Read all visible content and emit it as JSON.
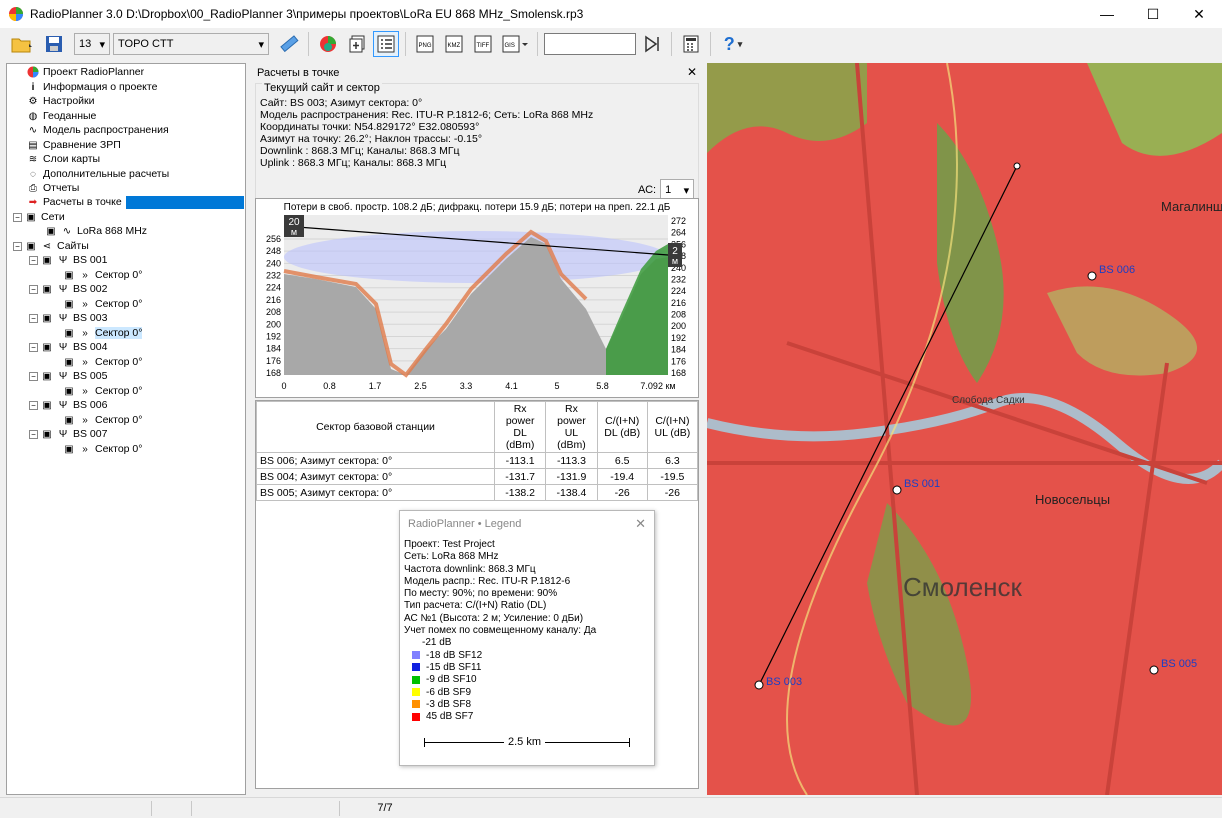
{
  "window": {
    "title": "RadioPlanner 3.0 D:\\Dropbox\\00_RadioPlanner 3\\примеры проектов\\LoRa EU 868 MHz_Smolensk.rp3"
  },
  "toolbar": {
    "font_size": "13",
    "layer": "TOPO CTT",
    "search_value": ""
  },
  "tree": {
    "items": [
      {
        "label": "Проект RadioPlanner",
        "icon": "globe-icon"
      },
      {
        "label": "Информация о проекте",
        "icon": "info-icon"
      },
      {
        "label": "Настройки",
        "icon": "gear-icon"
      },
      {
        "label": "Геоданные",
        "icon": "globe-grid-icon"
      },
      {
        "label": "Модель распространения",
        "icon": "wave-icon"
      },
      {
        "label": "Сравнение ЗРП",
        "icon": "compare-icon"
      },
      {
        "label": "Слои карты",
        "icon": "layers-icon"
      },
      {
        "label": "Дополнительные расчеты",
        "icon": "dashed-circle-icon"
      },
      {
        "label": "Отчеты",
        "icon": "printer-icon"
      },
      {
        "label": "Расчеты в точке",
        "icon": "arrow-icon"
      }
    ],
    "networks_label": "Сети",
    "network_item": "LoRa 868 MHz",
    "sites_label": "Сайты",
    "sites": [
      "BS 001",
      "BS 002",
      "BS 003",
      "BS 004",
      "BS 005",
      "BS 006",
      "BS 007"
    ],
    "sector_label": "Сектор 0°"
  },
  "panel": {
    "title": "Расчеты в точке",
    "group_title": "Текущий сайт и сектор",
    "info": [
      "Сайт: BS 003; Азимут сектора: 0°",
      "Модель распространения: Rec. ITU-R P.1812-6; Сеть: LoRa 868 MHz",
      "Координаты точки: N54.829172°  E32.080593°",
      "Азимут на точку: 26.2°; Наклон трассы: -0.15°",
      "Downlink : 868.3 МГц; Каналы: 868.3 МГц",
      "Uplink : 868.3 МГц; Каналы: 868.3 МГц"
    ],
    "ac_label": "АС:",
    "ac_value": "1"
  },
  "profile": {
    "header": "Потери в своб. простр. 108.2 дБ; дифракц. потери 15.9 дБ; потери на преп. 22.1 дБ",
    "left_badge": [
      "20",
      "м"
    ],
    "right_badge": [
      "2",
      "м"
    ],
    "y_left": [
      "256",
      "248",
      "240",
      "232",
      "224",
      "216",
      "208",
      "200",
      "192",
      "184",
      "176",
      "168"
    ],
    "y_right": [
      "272",
      "264",
      "256",
      "248",
      "240",
      "232",
      "224",
      "216",
      "208",
      "200",
      "192",
      "184",
      "176",
      "168"
    ],
    "x_ticks": [
      "0",
      "0.8",
      "1.7",
      "2.5",
      "3.3",
      "4.1",
      "5",
      "5.8",
      "7.092 км"
    ]
  },
  "results": {
    "headers": [
      "Сектор базовой станции",
      "Rx power DL (dBm)",
      "Rx power UL (dBm)",
      "C/(I+N) DL (dB)",
      "C/(I+N) UL (dB)"
    ],
    "rows": [
      [
        "BS 006; Азимут сектора: 0°",
        "-113.1",
        "-113.3",
        "6.5",
        "6.3"
      ],
      [
        "BS 004; Азимут сектора: 0°",
        "-131.7",
        "-131.9",
        "-19.4",
        "-19.5"
      ],
      [
        "BS 005; Азимут сектора: 0°",
        "-138.2",
        "-138.4",
        "-26",
        "-26"
      ]
    ]
  },
  "legend": {
    "title": "RadioPlanner • Legend",
    "lines": [
      "Проект: Test Project",
      "Сеть: LoRa 868 MHz",
      "Частота downlink: 868.3 МГц",
      "Модель распр.: Rec. ITU-R P.1812-6",
      "По месту: 90%; по времени: 90%",
      "Тип расчета: C/(I+N) Ratio (DL)",
      "АС №1 (Высота: 2 м; Усиление: 0 дБи)",
      "Учет помех по совмещенному каналу: Да"
    ],
    "first_level": "-21 dB",
    "levels": [
      {
        "label": "-18 dB SF12",
        "color": "#8080ff"
      },
      {
        "label": "-15 dB SF11",
        "color": "#1020e0"
      },
      {
        "label": "-9 dB SF10",
        "color": "#00c000"
      },
      {
        "label": "-6 dB SF9",
        "color": "#ffff00"
      },
      {
        "label": "-3 dB SF8",
        "color": "#ff9000"
      },
      {
        "label": "45 dB SF7",
        "color": "#ff0000"
      }
    ],
    "scale": "2.5 km"
  },
  "map": {
    "labels": {
      "magalin": "Магалинщ",
      "novoseltsy": "Новосельцы",
      "smolensk": "Смоленск",
      "sloboda": "Слобода Садки"
    },
    "stations": [
      "BS 006",
      "BS 001",
      "BS 003",
      "BS 005"
    ]
  },
  "status": {
    "page": "7/7"
  }
}
